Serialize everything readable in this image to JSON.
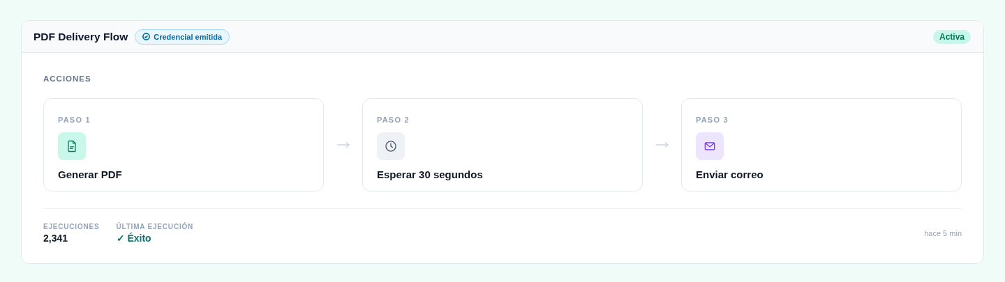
{
  "flow": {
    "title": "PDF Delivery Flow",
    "credential_badge": "Credencial emitida",
    "status": "Activa"
  },
  "section_label": "ACCIONES",
  "steps": [
    {
      "label": "PASO 1",
      "name": "Generar PDF",
      "kind": "document"
    },
    {
      "label": "PASO 2",
      "name": "Esperar 30 segundos",
      "kind": "clock"
    },
    {
      "label": "PASO 3",
      "name": "Enviar correo",
      "kind": "mail"
    }
  ],
  "stats": [
    {
      "label": "EJECUCIONES",
      "value": "2,341",
      "kind": "count"
    },
    {
      "label": "ÚLTIMA EJECUCIÓN",
      "value": "✓ Éxito",
      "kind": "success"
    }
  ],
  "last_run": "hace 5 min"
}
